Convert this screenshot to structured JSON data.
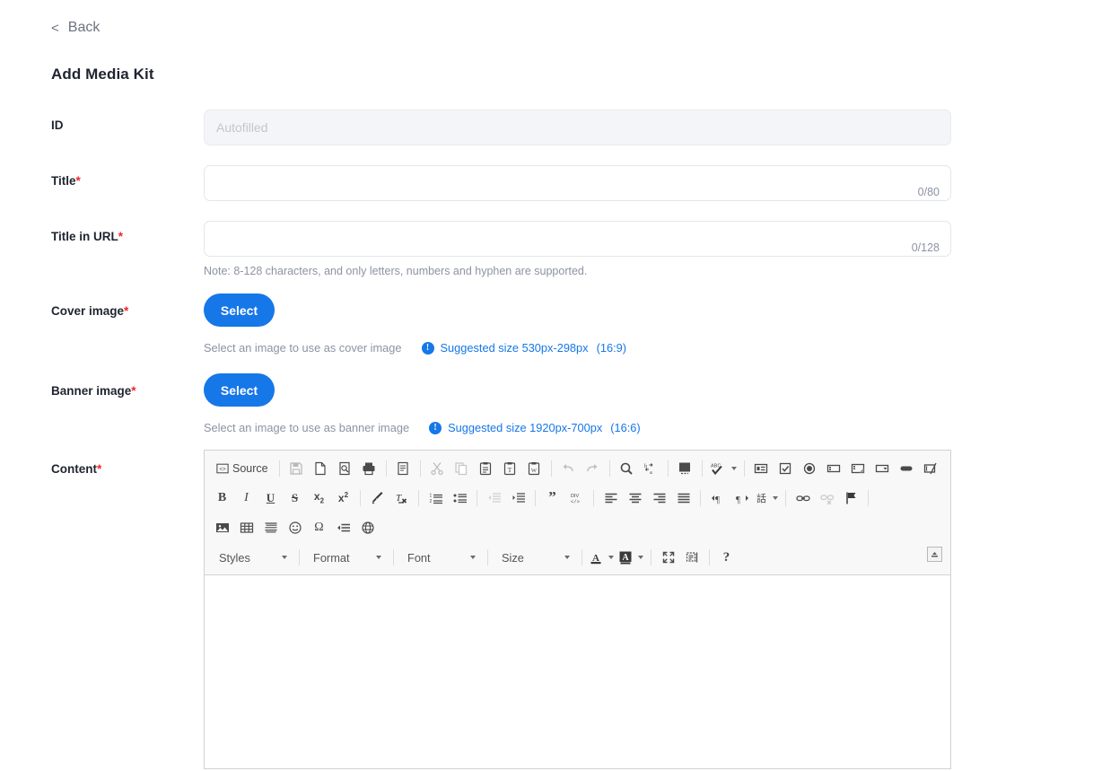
{
  "nav": {
    "back_label": "Back",
    "back_chevron": "<"
  },
  "header": {
    "title": "Add Media Kit"
  },
  "form": {
    "fields": {
      "id": {
        "label": "ID",
        "placeholder": "Autofilled",
        "value": ""
      },
      "title": {
        "label": "Title",
        "required_mark": "*",
        "value": "",
        "placeholder": "",
        "counter": "0/80"
      },
      "title_in_url": {
        "label": "Title in URL",
        "required_mark": "*",
        "value": "",
        "placeholder": "",
        "counter": "0/128",
        "note": "Note: 8-128 characters, and only letters, numbers and hyphen are supported."
      },
      "cover_image": {
        "label": "Cover image",
        "required_mark": "*",
        "button_label": "Select",
        "hint": "Select an image to use as cover image",
        "suggested": "Suggested size 530px-298px",
        "ratio": "(16:9)",
        "info_glyph": "!"
      },
      "banner_image": {
        "label": "Banner image",
        "required_mark": "*",
        "button_label": "Select",
        "hint": "Select an image to use as banner image",
        "suggested": "Suggested size 1920px-700px",
        "ratio": "(16:6)",
        "info_glyph": "!"
      },
      "content": {
        "label": "Content",
        "required_mark": "*",
        "value": ""
      }
    }
  },
  "editor": {
    "source_label": "Source",
    "dropdowns": [
      {
        "name": "styles",
        "label": "Styles"
      },
      {
        "name": "format",
        "label": "Format"
      },
      {
        "name": "font",
        "label": "Font"
      },
      {
        "name": "size",
        "label": "Size"
      }
    ],
    "toolbar_rows": [
      {
        "name": "row-1",
        "buttons": [
          "source",
          "sep",
          "save",
          "new-page",
          "preview",
          "print",
          "sep",
          "templates",
          "sep",
          "cut",
          "copy",
          "paste",
          "paste-text",
          "paste-word",
          "sep",
          "undo",
          "redo",
          "sep",
          "find",
          "replace",
          "sep",
          "select-all",
          "sep",
          "spell-check",
          "sep",
          "form",
          "checkbox",
          "radio",
          "text-field",
          "textarea",
          "select-field",
          "button",
          "image-button"
        ]
      },
      {
        "name": "row-2",
        "buttons": [
          "bold",
          "italic",
          "underline",
          "strike",
          "subscript",
          "superscript",
          "sep",
          "copy-formatting",
          "remove-format",
          "sep",
          "numbered-list",
          "bulleted-list",
          "sep",
          "decrease-indent",
          "increase-indent",
          "sep",
          "blockquote",
          "div-container",
          "sep",
          "align-left",
          "align-center",
          "align-right",
          "justify",
          "sep",
          "ltr",
          "rtl",
          "language",
          "sep",
          "link",
          "unlink",
          "anchor",
          "sep"
        ]
      },
      {
        "name": "row-3",
        "buttons": [
          "image",
          "table",
          "horizontal-rule",
          "smiley",
          "special-character",
          "page-break",
          "iframe"
        ]
      },
      {
        "name": "row-4",
        "buttons": [
          "styles",
          "format",
          "font",
          "size",
          "text-color",
          "bg-color",
          "maximize",
          "show-blocks",
          "about",
          "collapse"
        ]
      }
    ]
  },
  "colors": {
    "accent": "#1677e8",
    "required": "#f5222d",
    "label_text": "#1f2430",
    "muted_text": "#8c93a3",
    "border": "#e4e6ec",
    "toolbar_bg": "#f8f8f8",
    "editor_border": "#d1d1d1",
    "disabled_bg": "#f4f5f8"
  }
}
